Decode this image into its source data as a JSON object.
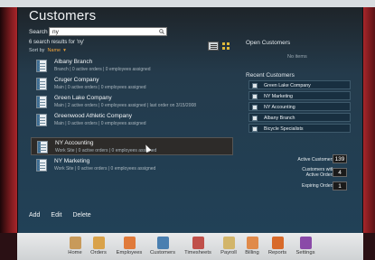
{
  "header": {
    "title": "Customers"
  },
  "search": {
    "label": "Search",
    "value": "ny"
  },
  "results": {
    "count_text": "6 search results for 'ny'",
    "sort_label": "Sort by",
    "sort_value": "Name"
  },
  "customers": [
    {
      "name": "Albany Branch",
      "sub": "Branch | 0 active orders | 0 employees assigned"
    },
    {
      "name": "Cruger Company",
      "sub": "Main | 0 active orders | 0 employees assigned"
    },
    {
      "name": "Green Lake Company",
      "sub": "Main | 2 active orders | 0 employees assigned | last order on 3/15/2008"
    },
    {
      "name": "Greenwood Athletic Company",
      "sub": "Main | 0 active orders | 0 employees assigned"
    },
    {
      "name": "NY Accounting",
      "sub": "Work Site | 0 active orders | 0 employees assigned"
    },
    {
      "name": "NY Marketing",
      "sub": "Work Site | 0 active orders | 0 employees assigned"
    }
  ],
  "open_customers": {
    "title": "Open Customers",
    "empty_text": "No items"
  },
  "recent_customers": {
    "title": "Recent Customers",
    "items": [
      "Green Lake Company",
      "NY Marketing",
      "NY Accounting",
      "Albany Branch",
      "Bicycle Specialists"
    ]
  },
  "stats": {
    "active_customers_label": "Active Customers",
    "active_customers": "139",
    "with_orders_label_1": "Customers with",
    "with_orders_label_2": "Active Orders",
    "with_orders": "4",
    "expiring_label": "Expiring Orders",
    "expiring": "1"
  },
  "actions": {
    "add": "Add",
    "edit": "Edit",
    "delete": "Delete"
  },
  "nav": [
    {
      "label": "Home",
      "color": "#c89a5a"
    },
    {
      "label": "Orders",
      "color": "#d9a24a"
    },
    {
      "label": "Employees",
      "color": "#e07a3a"
    },
    {
      "label": "Customers",
      "color": "#4a7fb0"
    },
    {
      "label": "Timesheets",
      "color": "#c0504a"
    },
    {
      "label": "Payroll",
      "color": "#d2b56a"
    },
    {
      "label": "Billing",
      "color": "#e08a4a"
    },
    {
      "label": "Reports",
      "color": "#d86a2a"
    },
    {
      "label": "Settings",
      "color": "#8a4aa8"
    }
  ]
}
